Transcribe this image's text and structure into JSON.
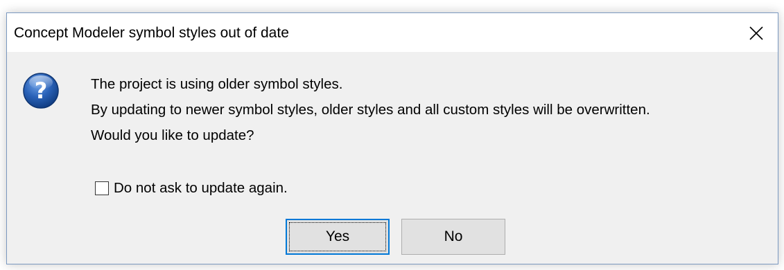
{
  "dialog": {
    "title": "Concept Modeler symbol styles out of date",
    "close_icon": "close-icon",
    "question_icon": "question-icon",
    "message_lines": [
      "The project is using older symbol styles.",
      "By updating to newer symbol styles, older styles and all custom styles will be overwritten.",
      "Would you like to update?"
    ],
    "checkbox": {
      "label": "Do not ask to update again.",
      "checked": false
    },
    "buttons": {
      "yes_label": "Yes",
      "no_label": "No"
    },
    "colors": {
      "accent": "#0078d7",
      "icon_blue": "#1d4f9c"
    }
  }
}
